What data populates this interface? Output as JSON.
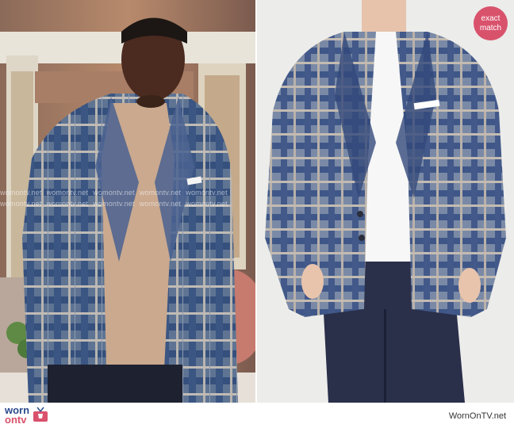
{
  "photos": {
    "left": {
      "alt": ""
    },
    "right": {
      "alt": ""
    }
  },
  "watermark": {
    "text": "womontv.net"
  },
  "badge": {
    "line1": "exact",
    "line2": "match"
  },
  "logo": {
    "line1": "worn",
    "line2": "on",
    "line3": "tv"
  },
  "footer": {
    "site": "WornOnTV.net"
  },
  "colors": {
    "badge": "#d9526c",
    "logo_blue": "#2a4a8c",
    "logo_pink": "#d9526c"
  }
}
